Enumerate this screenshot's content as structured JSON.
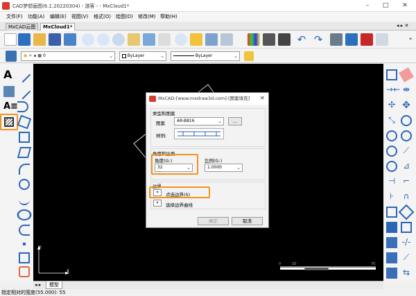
{
  "app": {
    "title": "CAD梦想画图(6.1.20220304) - 游客 - - MxCloud1*"
  },
  "menu": [
    "文件(F)",
    "功能(A)",
    "编辑(E)",
    "视图(V)",
    "格式(O)",
    "绘图(D)",
    "修改(M)",
    "帮助(H)"
  ],
  "tabs": [
    "MxCAD云图",
    "MxCloud1*"
  ],
  "layer_bar": {
    "layer": "0",
    "color": "ByLayer",
    "linetype": "ByLayer"
  },
  "canvas": {
    "ruler_labels": [
      "0",
      "10",
      "70"
    ],
    "y_axis": "Y",
    "x_axis": "X"
  },
  "model_tab": "模型",
  "status_text": "指定相对的宽度(55.000):  55",
  "dialog": {
    "title": "MxCAD-[www.mxdraw3d.com]-[图案填充]",
    "close": "✕",
    "section_type": "类型和图案",
    "pattern_label": "图案",
    "pattern_value": "AR-B816",
    "browse": "...",
    "sample_label": "样例:",
    "section_angle": "角度和比例",
    "angle_label": "角度(G:)",
    "angle_value": "32",
    "scale_label": "比例(G:)",
    "scale_value": "1.0000",
    "section_boundary": "边界",
    "pick_points": "点选边界(S)",
    "select_objects": "选择边界曲线",
    "ok": "确定",
    "cancel": "取消"
  }
}
